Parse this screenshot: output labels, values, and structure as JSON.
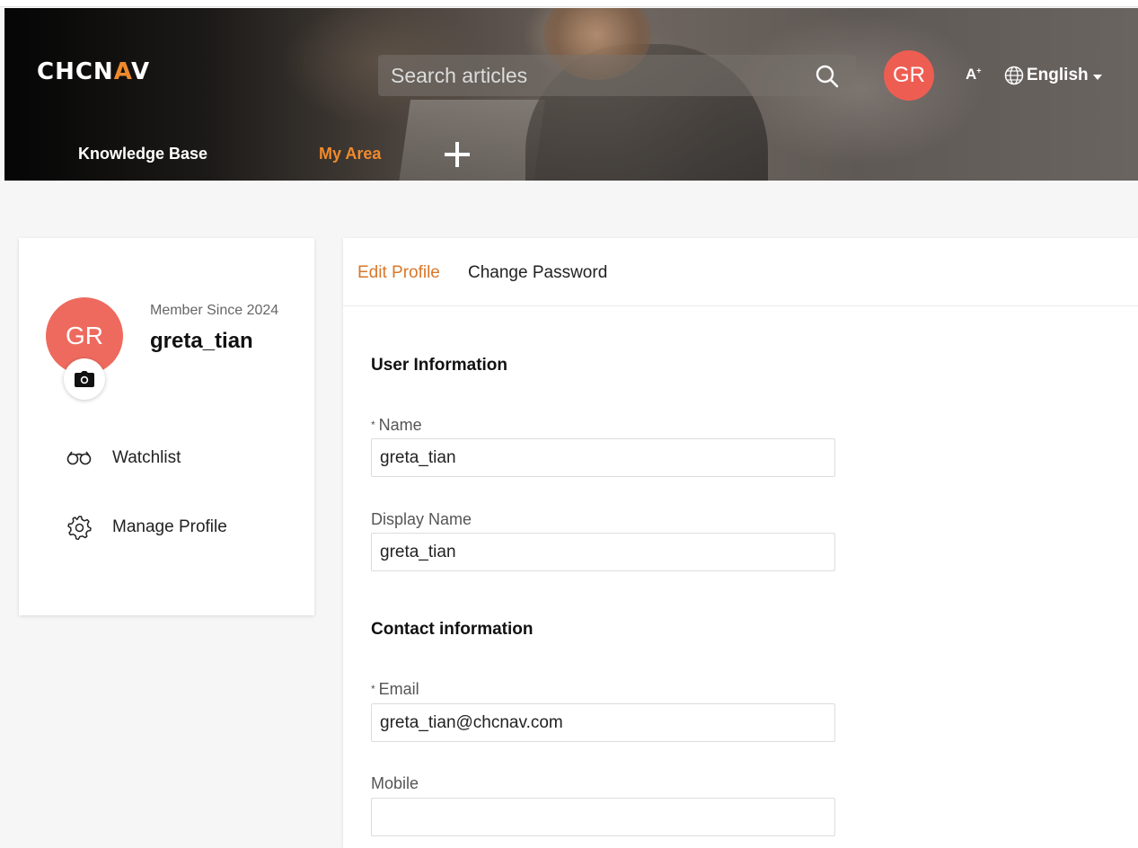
{
  "header": {
    "logo_left": "CHCN",
    "logo_accent": "A",
    "logo_right": "V",
    "search_placeholder": "Search articles",
    "avatar_initials": "GR",
    "a11y_label": "A",
    "language": "English",
    "nav": {
      "knowledge_base": "Knowledge Base",
      "my_area": "My Area"
    },
    "accent_color": "#f08a2c"
  },
  "profile": {
    "initials": "GR",
    "member_since": "Member Since 2024",
    "username": "greta_tian",
    "menu": {
      "watchlist": "Watchlist",
      "manage_profile": "Manage Profile"
    }
  },
  "form": {
    "tabs": {
      "edit_profile": "Edit Profile",
      "change_password": "Change Password"
    },
    "user_section": "User Information",
    "name_label": "Name",
    "name_value": "greta_tian",
    "display_label": "Display Name",
    "display_value": "greta_tian",
    "contact_section": "Contact information",
    "email_label": "Email",
    "email_value": "greta_tian@chcnav.com",
    "mobile_label": "Mobile",
    "mobile_value": "",
    "required_mark": "*"
  },
  "icons": [
    "search-icon",
    "accessibility-icon",
    "globe-icon",
    "chevron-down-icon",
    "plus-icon",
    "camera-icon",
    "binoculars-icon",
    "gear-icon"
  ]
}
